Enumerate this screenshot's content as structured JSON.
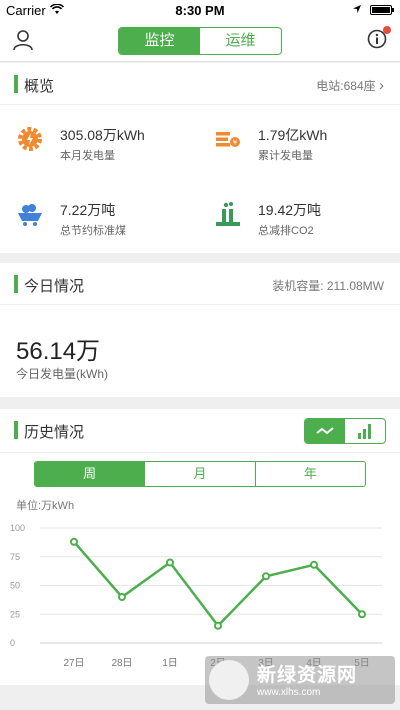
{
  "status_bar": {
    "carrier": "Carrier",
    "time": "8:30 PM"
  },
  "nav": {
    "tabs": [
      "监控",
      "运维"
    ],
    "active_tab": 0
  },
  "overview": {
    "title": "概览",
    "station_link": "电站:684座",
    "stats": [
      {
        "value": "305.08万kWh",
        "label": "本月发电量",
        "icon": "gear-energy-icon"
      },
      {
        "value": "1.79亿kWh",
        "label": "累计发电量",
        "icon": "stack-coin-icon"
      },
      {
        "value": "7.22万吨",
        "label": "总节约标准煤",
        "icon": "coal-cart-icon"
      },
      {
        "value": "19.42万吨",
        "label": "总减排CO2",
        "icon": "factory-icon"
      }
    ]
  },
  "today": {
    "title": "今日情况",
    "capacity": "装机容量: 211.08MW",
    "value": "56.14万",
    "label": "今日发电量(kWh)"
  },
  "history": {
    "title": "历史情况",
    "periods": [
      "周",
      "月",
      "年"
    ],
    "active_period": 0,
    "unit": "单位:万kWh"
  },
  "chart_data": {
    "type": "line",
    "y_ticks": [
      0,
      25,
      50,
      75,
      100
    ],
    "ylim": [
      0,
      100
    ],
    "categories": [
      "27日",
      "28日",
      "1日",
      "2日",
      "3日",
      "4日",
      "5日"
    ],
    "series": [
      {
        "values": [
          88,
          40,
          70,
          15,
          58,
          68,
          25
        ]
      }
    ]
  },
  "watermark": {
    "title": "新绿资源网",
    "url": "www.xlhs.com"
  },
  "colors": {
    "accent": "#4cae4c",
    "orange": "#f08a30",
    "blue": "#3f82d8",
    "green_icon": "#3a9a58"
  }
}
